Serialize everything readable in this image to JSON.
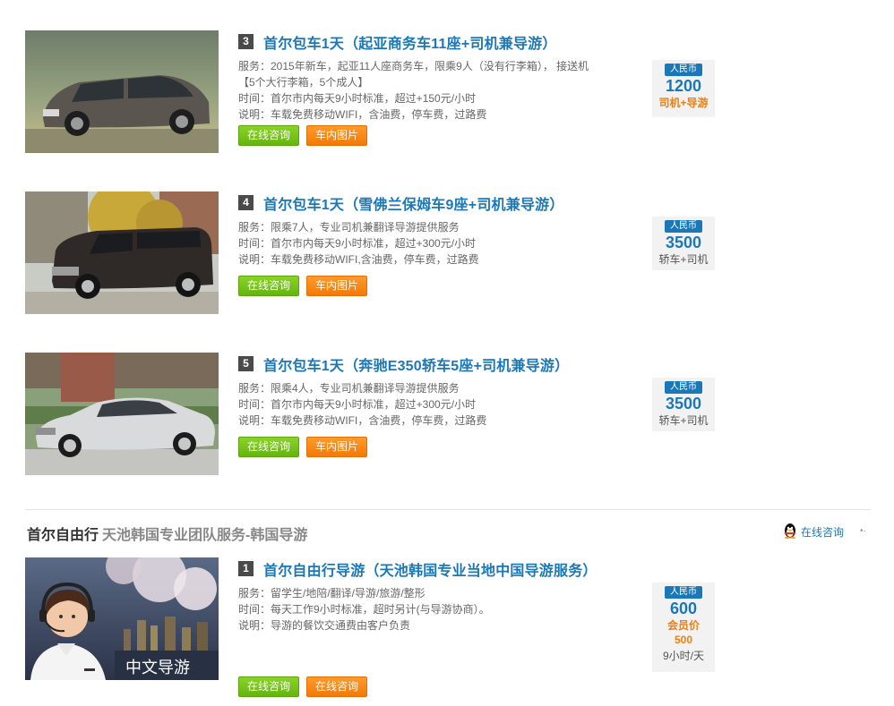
{
  "items": [
    {
      "num": "3",
      "title": "首尔包车1天（起亚商务车11座+司机兼导游）",
      "lines": [
        "服务：2015年新车，起亚11人座商务车，限乘9人（没有行李箱）， 接送机",
        "【5个大行李箱，5个成人】",
        "时间：首尔市内每天9小时标准，超过+150元/小时",
        "说明：车载免费移动WIFI，含油费，停车费，过路费"
      ],
      "btn_consult": "在线咨询",
      "btn_photos": "车内图片",
      "price_tag": "人民币",
      "price": "1200",
      "price_note": "司机+导游"
    },
    {
      "num": "4",
      "title": "首尔包车1天（雪佛兰保姆车9座+司机兼导游）",
      "lines": [
        "服务：限乘7人，专业司机兼翻译导游提供服务",
        "时间：首尔市内每天9小时标准，超过+300元/小时",
        "说明：车载免费移动WIFI,含油费，停车费，过路费"
      ],
      "btn_consult": "在线咨询",
      "btn_photos": "车内图片",
      "price_tag": "人民币",
      "price": "3500",
      "price_note": "轿车+司机"
    },
    {
      "num": "5",
      "title": "首尔包车1天（奔驰E350轿车5座+司机兼导游）",
      "lines": [
        "服务：限乘4人，专业司机兼翻译导游提供服务",
        "时间：首尔市内每天9小时标准，超过+300元/小时",
        "说明：车载免费移动WIFI，含油费，停车费，过路费"
      ],
      "btn_consult": "在线咨询",
      "btn_photos": "车内图片",
      "price_tag": "人民币",
      "price": "3500",
      "price_note": "轿车+司机"
    }
  ],
  "section": {
    "title": "首尔自由行",
    "subtitle": "天池韩国专业团队服务-韩国导游",
    "consult_label": "在线咨询"
  },
  "guide_item": {
    "num": "1",
    "title": "首尔自由行导游（天池韩国专业当地中国导游服务）",
    "lines": [
      "服务：留学生/地陪/翻译/导游/旅游/整形",
      "时间：每天工作9小时标准，超时另计(与导游协商）。",
      "说明：导游的餐饮交通费由客户负责"
    ],
    "image_caption": "中文导游",
    "btn_consult": "在线咨询",
    "btn_consult2": "在线咨询",
    "price_tag": "人民币",
    "price": "600",
    "member_label": "会员价",
    "member_price": "500",
    "unit": "9小时/天"
  },
  "colors": {
    "link_blue": "#1a78b8",
    "green_button": "#64b510",
    "orange_button": "#f27a08",
    "orange_text": "#f07d0f"
  }
}
